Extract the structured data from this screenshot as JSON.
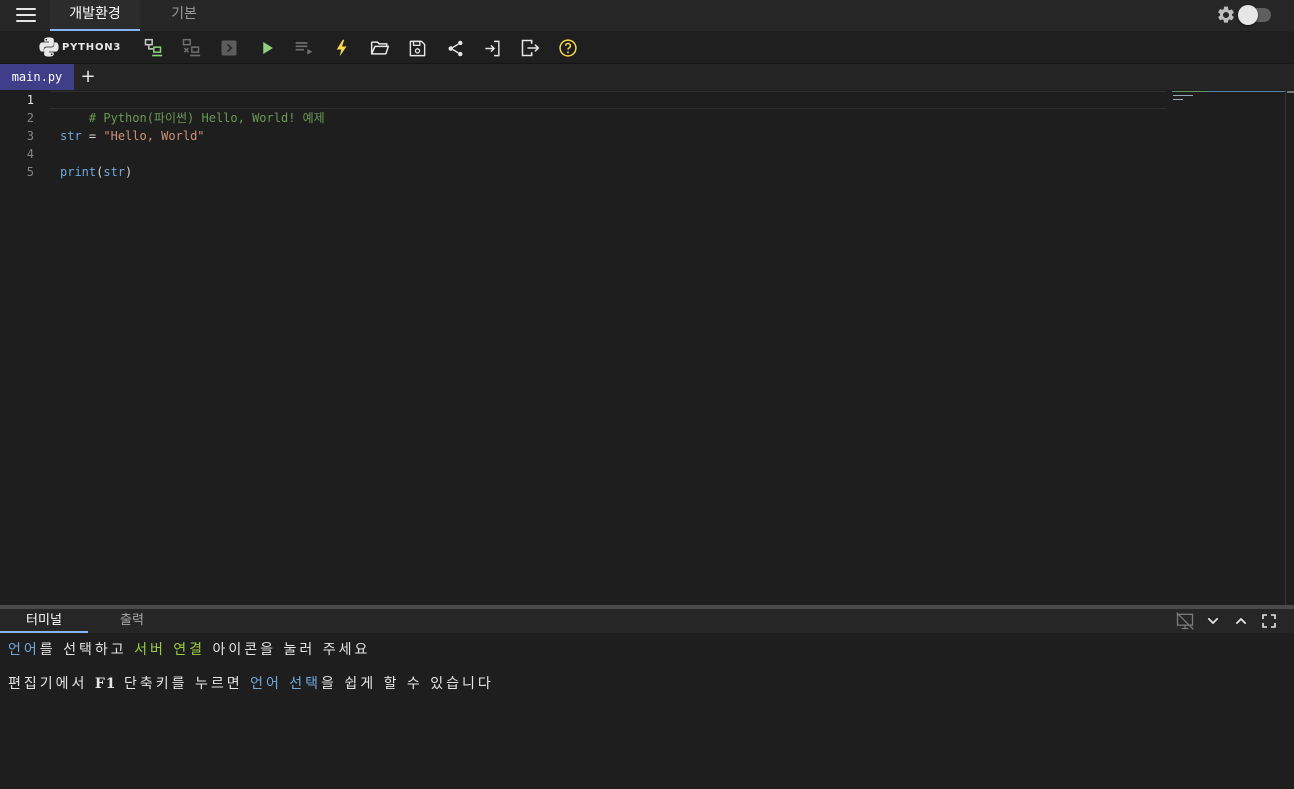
{
  "topbar": {
    "tabs": [
      {
        "label": "개발환경",
        "active": true
      },
      {
        "label": "기본",
        "active": false
      }
    ]
  },
  "toolbar": {
    "language": "PYTHON3",
    "buttons": [
      {
        "icon": "server-connect-icon",
        "color": "#8bd17c"
      },
      {
        "icon": "server-disconnect-icon",
        "color": "#6f6f6f"
      },
      {
        "icon": "terminal-prompt-icon",
        "color": "#6f6f6f"
      },
      {
        "icon": "play-icon",
        "color": "#8bd17c"
      },
      {
        "icon": "playlist-run-icon",
        "color": "#6f6f6f"
      },
      {
        "icon": "lightning-icon",
        "color": "#f6d94a"
      },
      {
        "icon": "folder-open-icon",
        "color": "#e6e6e6"
      },
      {
        "icon": "save-icon",
        "color": "#e6e6e6"
      },
      {
        "icon": "share-icon",
        "color": "#e6e6e6"
      },
      {
        "icon": "login-icon",
        "color": "#e6e6e6"
      },
      {
        "icon": "logout-icon",
        "color": "#e6e6e6"
      },
      {
        "icon": "help-icon",
        "color": "#f6d94a"
      }
    ]
  },
  "file_tabs": {
    "active_file": "main.py",
    "add_label": "+"
  },
  "editor": {
    "line_numbers": [
      "1",
      "2",
      "3",
      "4",
      "5"
    ],
    "code": {
      "comment": "# Python(파이썬) Hello, World! 예제",
      "l3_var": "str",
      "l3_op": " = ",
      "l3_str": "\"Hello, World\"",
      "l5_fn": "print",
      "l5_open": "(",
      "l5_arg": "str",
      "l5_close": ")"
    }
  },
  "panel": {
    "tabs": [
      {
        "label": "터미널",
        "active": true
      },
      {
        "label": "출력",
        "active": false
      }
    ],
    "terminal": {
      "line1": [
        "언어",
        "를 선택하고 ",
        "서버 연결",
        " 아이콘을 눌러 주세요"
      ],
      "line2": [
        "편집기에서 ",
        "F1",
        " 단축키를 누르면 ",
        "언어 선택",
        "을 쉽게 할 수 있습니다"
      ]
    }
  },
  "colors": {
    "accent": "#8ab4f8",
    "file_tab": "#3e3f88",
    "highlight_blue": "#6fa8dc",
    "highlight_green": "#9ccc44"
  }
}
